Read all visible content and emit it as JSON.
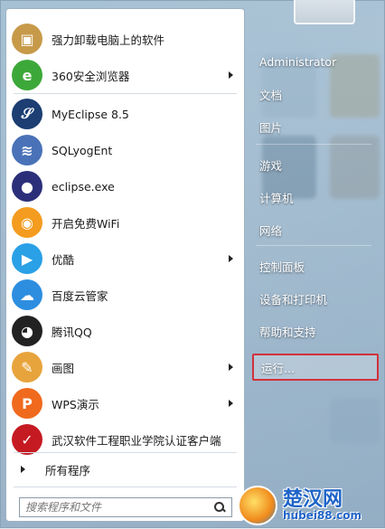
{
  "programs": [
    {
      "label": "强力卸载电脑上的软件",
      "icon": "uninstall-box-icon",
      "has_arrow": false,
      "color": "#c79a4a"
    },
    {
      "label": "360安全浏览器",
      "icon": "360-browser-icon",
      "has_arrow": true,
      "color": "#3da83a"
    },
    {
      "label": "MyEclipse 8.5",
      "icon": "myeclipse-icon",
      "has_arrow": false,
      "color": "#1c3e73"
    },
    {
      "label": "SQLyogEnt",
      "icon": "sqlyog-dolphin-icon",
      "has_arrow": false,
      "color": "#4a72b8"
    },
    {
      "label": "eclipse.exe",
      "icon": "eclipse-icon",
      "has_arrow": false,
      "color": "#2b2f7a"
    },
    {
      "label": "开启免费WiFi",
      "icon": "wifi-icon",
      "has_arrow": false,
      "color": "#f39c1f"
    },
    {
      "label": "优酷",
      "icon": "youku-play-icon",
      "has_arrow": true,
      "color": "#2aa0e6"
    },
    {
      "label": "百度云管家",
      "icon": "baidu-cloud-icon",
      "has_arrow": false,
      "color": "#2d8ee0"
    },
    {
      "label": "腾讯QQ",
      "icon": "qq-penguin-icon",
      "has_arrow": false,
      "color": "#222222"
    },
    {
      "label": "画图",
      "icon": "paint-palette-icon",
      "has_arrow": true,
      "color": "#e8a43c"
    },
    {
      "label": "WPS演示",
      "icon": "wps-presentation-icon",
      "has_arrow": true,
      "color": "#f06a1e"
    },
    {
      "label": "武汉软件工程职业学院认证客户端",
      "icon": "auth-client-icon",
      "has_arrow": false,
      "color": "#c61a22"
    }
  ],
  "all_programs_label": "所有程序",
  "search": {
    "placeholder": "搜索程序和文件"
  },
  "right_items": [
    {
      "label": "Administrator"
    },
    {
      "label": "文档"
    },
    {
      "label": "图片"
    },
    {
      "label": "游戏"
    },
    {
      "label": "计算机"
    },
    {
      "label": "网络"
    },
    {
      "label": "控制面板"
    },
    {
      "label": "设备和打印机"
    },
    {
      "label": "帮助和支持"
    },
    {
      "label": "运行..."
    }
  ],
  "watermark": {
    "title": "楚汉网",
    "url": "hubei88.com"
  },
  "colors": {
    "highlight_border": "#d2303a",
    "watermark_blue": "#1f64c8"
  }
}
